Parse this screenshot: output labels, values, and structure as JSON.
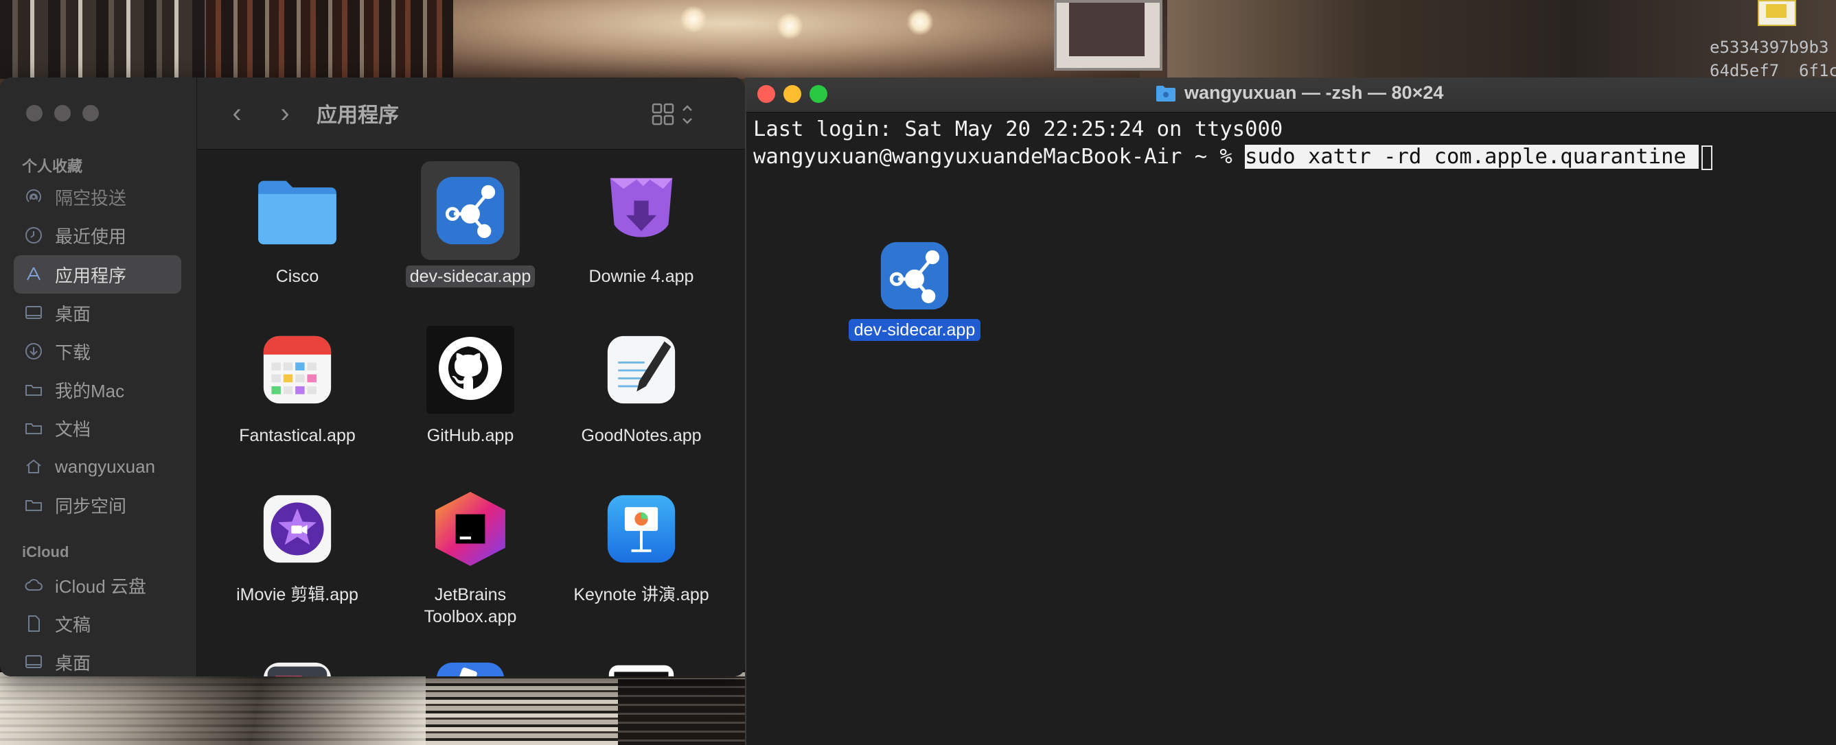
{
  "wallpaper": {
    "hash_lines": [
      "e5334397b9b3",
      "64d5ef7  6f1c"
    ]
  },
  "finder": {
    "sidebar": {
      "favorites_title": "个人收藏",
      "favorites": [
        {
          "label": "隔空投送",
          "icon": "airdrop-icon"
        },
        {
          "label": "最近使用",
          "icon": "clock-icon"
        },
        {
          "label": "应用程序",
          "icon": "applications-icon",
          "selected": true
        },
        {
          "label": "桌面",
          "icon": "desktop-icon"
        },
        {
          "label": "下载",
          "icon": "download-icon"
        },
        {
          "label": "我的Mac",
          "icon": "folder-icon"
        },
        {
          "label": "文档",
          "icon": "folder-icon"
        },
        {
          "label": "wangyuxuan",
          "icon": "home-icon"
        },
        {
          "label": "同步空间",
          "icon": "folder-icon"
        }
      ],
      "icloud_title": "iCloud",
      "icloud": [
        {
          "label": "iCloud 云盘",
          "icon": "cloud-icon"
        },
        {
          "label": "文稿",
          "icon": "document-icon"
        },
        {
          "label": "桌面",
          "icon": "desktop-icon"
        }
      ]
    },
    "toolbar": {
      "back": "‹",
      "forward": "›",
      "title": "应用程序"
    },
    "items": [
      {
        "label": "Cisco",
        "icon": "folder-icon"
      },
      {
        "label": "dev-sidecar.app",
        "icon": "dev-sidecar-icon",
        "selected": true
      },
      {
        "label": "Downie 4.app",
        "icon": "downie-icon"
      },
      {
        "label": "Fantastical.app",
        "icon": "fantastical-icon"
      },
      {
        "label": "GitHub.app",
        "icon": "github-icon"
      },
      {
        "label": "GoodNotes.app",
        "icon": "goodnotes-icon"
      },
      {
        "label": "iMovie 剪辑.app",
        "icon": "imovie-icon"
      },
      {
        "label": "JetBrains Toolbox.app",
        "line1": "JetBrains",
        "line2": "Toolbox.app",
        "icon": "jetbrains-icon"
      },
      {
        "label": "Keynote 讲演.app",
        "icon": "keynote-icon"
      }
    ]
  },
  "terminal": {
    "title": "wangyuxuan — -zsh — 80×24",
    "line1": "Last login: Sat May 20 22:25:24 on ttys000",
    "prompt": "wangyuxuan@wangyuxuandeMacBook-Air ~ % ",
    "command": "sudo xattr -rd com.apple.quarantine ",
    "drag_item_label": "dev-sidecar.app"
  },
  "colors": {
    "selection_blue": "#1f5cd1",
    "close": "#ff5f57",
    "minimize": "#febc2e",
    "zoom": "#28c840",
    "sidebar_icon": "#7c9fd6"
  }
}
